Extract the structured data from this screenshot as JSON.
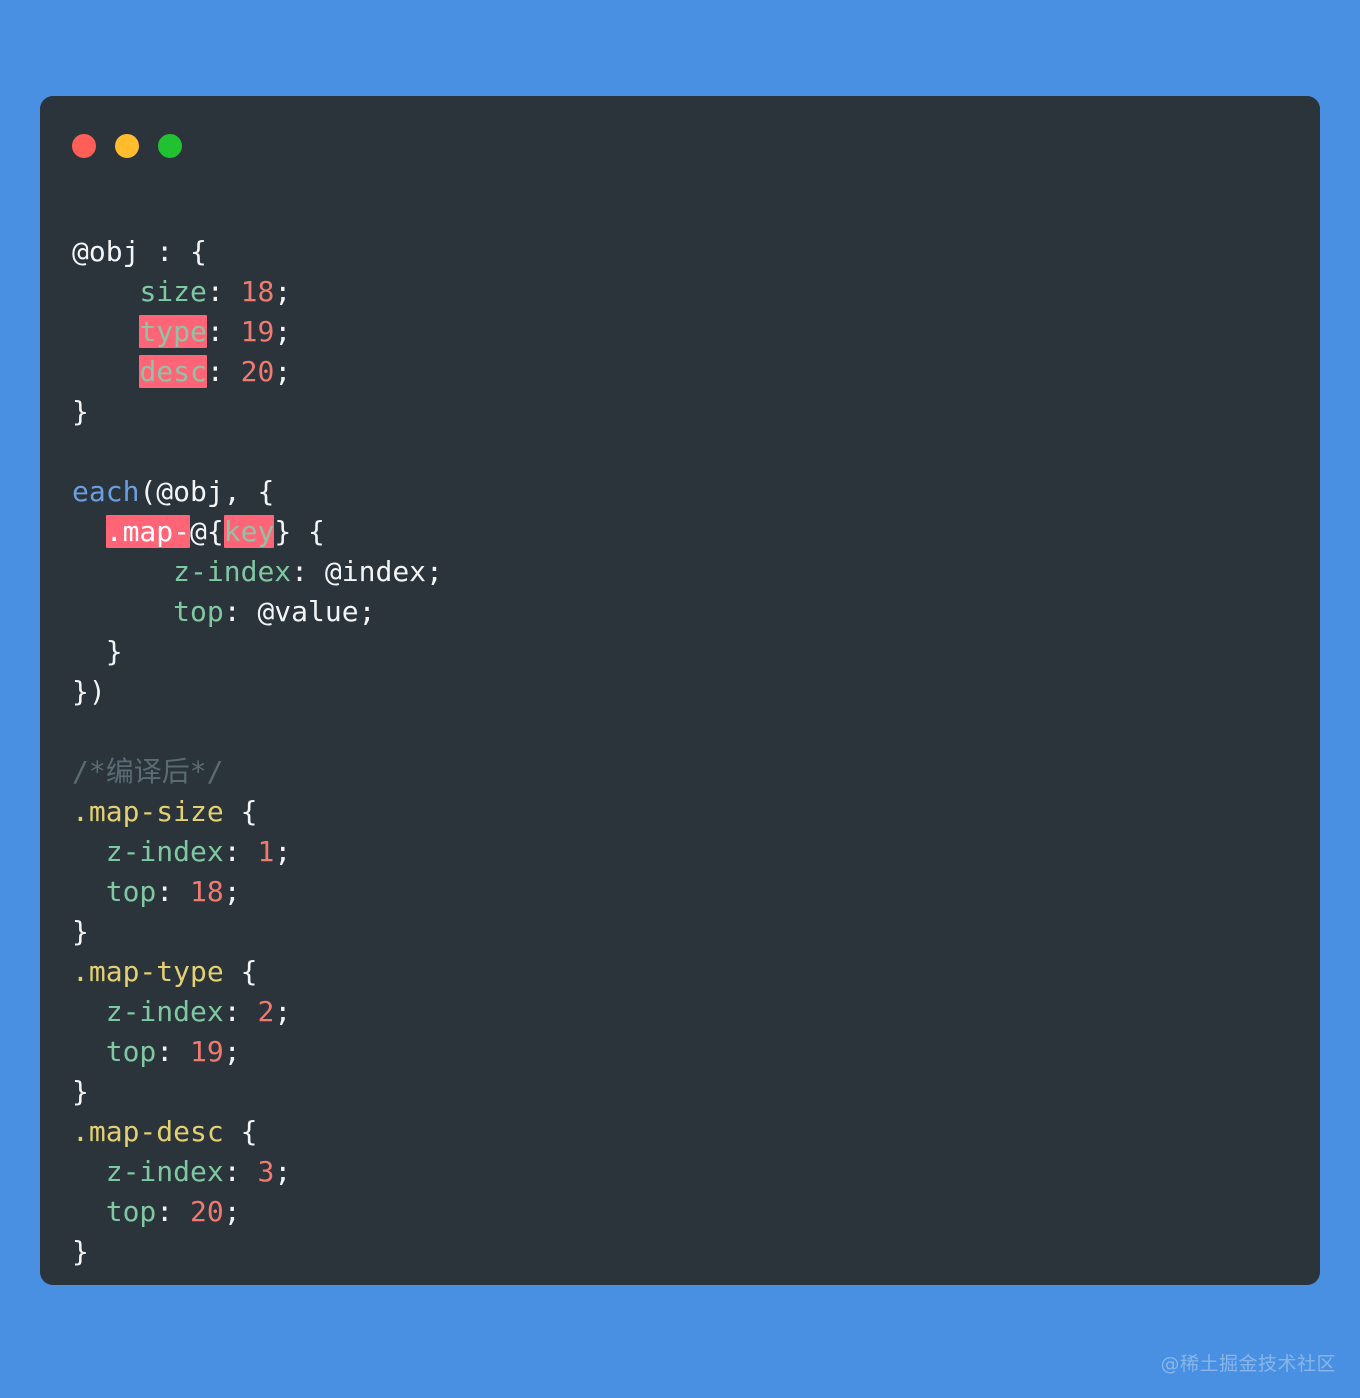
{
  "theme": {
    "page_background": "#4a90e2",
    "card_background": "#2b333b",
    "highlight_background": "#ff6576",
    "text_default": "#f2f4f5",
    "property_color": "#7fc9a2",
    "number_color": "#f07a70",
    "function_color": "#6a9fe0",
    "selector_color": "#e3d071",
    "comment_color": "#5a6b74"
  },
  "window_controls": [
    {
      "name": "close",
      "color": "#ff5f56"
    },
    {
      "name": "minimize",
      "color": "#ffbd2e"
    },
    {
      "name": "maximize",
      "color": "#22c131"
    }
  ],
  "code": {
    "language": "less",
    "lines": [
      {
        "id": "l01",
        "segments": [
          {
            "text": "@obj : {",
            "style": "plain"
          }
        ]
      },
      {
        "id": "l02",
        "segments": [
          {
            "text": "    ",
            "style": "plain"
          },
          {
            "text": "size",
            "style": "prop"
          },
          {
            "text": ": ",
            "style": "plain"
          },
          {
            "text": "18",
            "style": "num"
          },
          {
            "text": ";",
            "style": "plain"
          }
        ]
      },
      {
        "id": "l03",
        "segments": [
          {
            "text": "    ",
            "style": "plain"
          },
          {
            "text": "type",
            "style": "prop-highlight"
          },
          {
            "text": ": ",
            "style": "plain"
          },
          {
            "text": "19",
            "style": "num"
          },
          {
            "text": ";",
            "style": "plain"
          }
        ]
      },
      {
        "id": "l04",
        "segments": [
          {
            "text": "    ",
            "style": "plain"
          },
          {
            "text": "desc",
            "style": "prop-highlight"
          },
          {
            "text": ": ",
            "style": "plain"
          },
          {
            "text": "20",
            "style": "num"
          },
          {
            "text": ";",
            "style": "plain"
          }
        ]
      },
      {
        "id": "l05",
        "segments": [
          {
            "text": "}",
            "style": "plain"
          }
        ]
      },
      {
        "id": "l06",
        "segments": [
          {
            "text": "",
            "style": "plain"
          }
        ]
      },
      {
        "id": "l07",
        "segments": [
          {
            "text": "each",
            "style": "fn"
          },
          {
            "text": "(@obj, {",
            "style": "plain"
          }
        ]
      },
      {
        "id": "l08",
        "segments": [
          {
            "text": "  ",
            "style": "plain"
          },
          {
            "text": ".map-",
            "style": "highlight"
          },
          {
            "text": "@{",
            "style": "plain"
          },
          {
            "text": "key",
            "style": "prop-highlight"
          },
          {
            "text": "} {",
            "style": "plain"
          }
        ]
      },
      {
        "id": "l09",
        "segments": [
          {
            "text": "      ",
            "style": "plain"
          },
          {
            "text": "z-index",
            "style": "prop"
          },
          {
            "text": ": @index;",
            "style": "plain"
          }
        ]
      },
      {
        "id": "l10",
        "segments": [
          {
            "text": "      ",
            "style": "plain"
          },
          {
            "text": "top",
            "style": "prop"
          },
          {
            "text": ": @value;",
            "style": "plain"
          }
        ]
      },
      {
        "id": "l11",
        "segments": [
          {
            "text": "  }",
            "style": "plain"
          }
        ]
      },
      {
        "id": "l12",
        "segments": [
          {
            "text": "})",
            "style": "plain"
          }
        ]
      },
      {
        "id": "l13",
        "segments": [
          {
            "text": "",
            "style": "plain"
          }
        ]
      },
      {
        "id": "l14",
        "segments": [
          {
            "text": "/*编译后*/",
            "style": "cmt"
          }
        ]
      },
      {
        "id": "l15",
        "segments": [
          {
            "text": ".map-size",
            "style": "sel"
          },
          {
            "text": " {",
            "style": "plain"
          }
        ]
      },
      {
        "id": "l16",
        "segments": [
          {
            "text": "  ",
            "style": "plain"
          },
          {
            "text": "z-index",
            "style": "prop"
          },
          {
            "text": ": ",
            "style": "plain"
          },
          {
            "text": "1",
            "style": "num"
          },
          {
            "text": ";",
            "style": "plain"
          }
        ]
      },
      {
        "id": "l17",
        "segments": [
          {
            "text": "  ",
            "style": "plain"
          },
          {
            "text": "top",
            "style": "prop"
          },
          {
            "text": ": ",
            "style": "plain"
          },
          {
            "text": "18",
            "style": "num"
          },
          {
            "text": ";",
            "style": "plain"
          }
        ]
      },
      {
        "id": "l18",
        "segments": [
          {
            "text": "}",
            "style": "plain"
          }
        ]
      },
      {
        "id": "l19",
        "segments": [
          {
            "text": ".map-type",
            "style": "sel"
          },
          {
            "text": " {",
            "style": "plain"
          }
        ]
      },
      {
        "id": "l20",
        "segments": [
          {
            "text": "  ",
            "style": "plain"
          },
          {
            "text": "z-index",
            "style": "prop"
          },
          {
            "text": ": ",
            "style": "plain"
          },
          {
            "text": "2",
            "style": "num"
          },
          {
            "text": ";",
            "style": "plain"
          }
        ]
      },
      {
        "id": "l21",
        "segments": [
          {
            "text": "  ",
            "style": "plain"
          },
          {
            "text": "top",
            "style": "prop"
          },
          {
            "text": ": ",
            "style": "plain"
          },
          {
            "text": "19",
            "style": "num"
          },
          {
            "text": ";",
            "style": "plain"
          }
        ]
      },
      {
        "id": "l22",
        "segments": [
          {
            "text": "}",
            "style": "plain"
          }
        ]
      },
      {
        "id": "l23",
        "segments": [
          {
            "text": ".map-desc",
            "style": "sel"
          },
          {
            "text": " {",
            "style": "plain"
          }
        ]
      },
      {
        "id": "l24",
        "segments": [
          {
            "text": "  ",
            "style": "plain"
          },
          {
            "text": "z-index",
            "style": "prop"
          },
          {
            "text": ": ",
            "style": "plain"
          },
          {
            "text": "3",
            "style": "num"
          },
          {
            "text": ";",
            "style": "plain"
          }
        ]
      },
      {
        "id": "l25",
        "segments": [
          {
            "text": "  ",
            "style": "plain"
          },
          {
            "text": "top",
            "style": "prop"
          },
          {
            "text": ": ",
            "style": "plain"
          },
          {
            "text": "20",
            "style": "num"
          },
          {
            "text": ";",
            "style": "plain"
          }
        ]
      },
      {
        "id": "l26",
        "segments": [
          {
            "text": "}",
            "style": "plain"
          }
        ]
      }
    ]
  },
  "watermark": {
    "text": "@稀土掘金技术社区"
  }
}
